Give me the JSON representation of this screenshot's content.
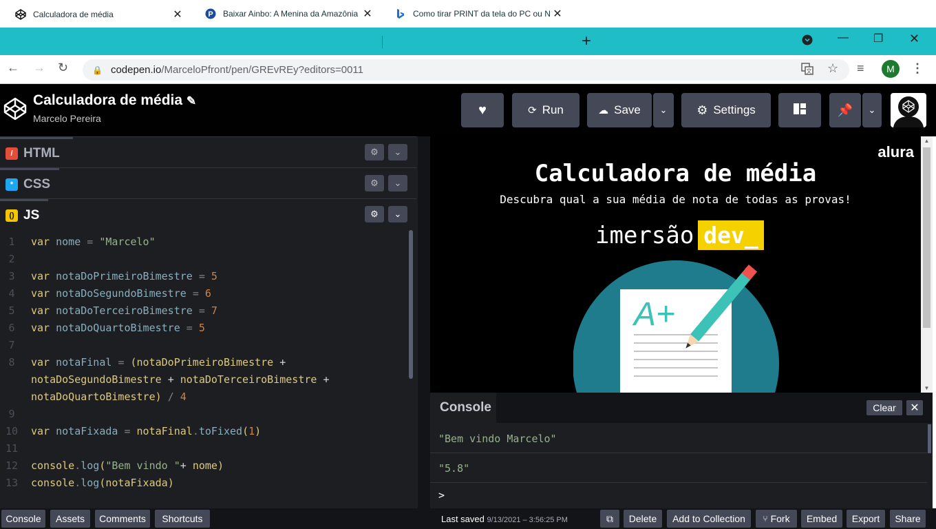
{
  "browser": {
    "tabs": [
      {
        "title": "Calculadora de média",
        "icon": "codepen-icon"
      },
      {
        "title": "Baixar Ainbo: A Menina da Amazônia",
        "icon": "pirate-bay-icon"
      },
      {
        "title": "Como tirar PRINT da tela do PC ou N",
        "icon": "bing-icon"
      }
    ],
    "url_host": "codepen.io",
    "url_path": "/MarceloPfront/pen/GREvREy?editors=0011",
    "profile_initial": "M"
  },
  "pen": {
    "title": "Calculadora de média",
    "author": "Marcelo Pereira",
    "buttons": {
      "run": "Run",
      "save": "Save",
      "settings": "Settings"
    }
  },
  "editors": {
    "html": "HTML",
    "css": "CSS",
    "js": "JS"
  },
  "code_lines": [
    {
      "n": "1"
    },
    {
      "n": "2"
    },
    {
      "n": "3"
    },
    {
      "n": "4"
    },
    {
      "n": "5"
    },
    {
      "n": "6"
    },
    {
      "n": "7"
    },
    {
      "n": "8"
    },
    {
      "n": "9"
    },
    {
      "n": "10"
    },
    {
      "n": "11"
    },
    {
      "n": "12"
    },
    {
      "n": "13"
    }
  ],
  "code": {
    "l1": [
      "var",
      "nome",
      "=",
      "\"Marcelo\""
    ],
    "l3": [
      "var",
      "notaDoPrimeiroBimestre",
      "=",
      "5"
    ],
    "l4": [
      "var",
      "notaDoSegundoBimestre",
      "=",
      "6"
    ],
    "l5": [
      "var",
      "notaDoTerceiroBimestre",
      "=",
      "7"
    ],
    "l6": [
      "var",
      "notaDoQuartoBimestre",
      "=",
      "5"
    ],
    "l8a": [
      "var",
      "notaFinal",
      "=",
      "(",
      "notaDoPrimeiroBimestre",
      "+"
    ],
    "l8b": [
      "notaDoSegundoBimestre",
      "+",
      "notaDoTerceiroBimestre",
      "+"
    ],
    "l8c": [
      "notaDoQuartoBimestre",
      ")",
      "/",
      "4"
    ],
    "l10": [
      "var",
      "notaFixada",
      "=",
      "notaFinal",
      ".",
      "toFixed",
      "(",
      "1",
      ")"
    ],
    "l12": [
      "console",
      ".",
      "log",
      "(",
      "\"Bem vindo \"",
      "+",
      "nome",
      ")"
    ],
    "l13": [
      "console",
      ".",
      "log",
      "(",
      "notaFixada",
      ")"
    ]
  },
  "preview": {
    "brand": "alura",
    "heading": "Calculadora de média",
    "subheading": "Descubra qual a sua média de nota de todas as provas!",
    "logo_text": "imersão",
    "logo_badge": "dev_",
    "grade_text": "A+"
  },
  "console": {
    "title": "Console",
    "clear": "Clear",
    "outputs": [
      "\"Bem vindo Marcelo\"",
      "\"5.8\""
    ],
    "prompt": ">"
  },
  "footer": {
    "left": [
      "Console",
      "Assets",
      "Comments",
      "Shortcuts"
    ],
    "saved_label": "Last saved",
    "saved_time": "9/13/2021 – 3:56:25 PM",
    "right": [
      "Delete",
      "Add to Collection",
      "Fork",
      "Embed",
      "Export",
      "Share"
    ]
  },
  "colors": {
    "tabstrip": "#1fbdc6",
    "codepen_bg": "#010101",
    "button": "#444857",
    "editor_bg": "#1d1e22",
    "dev_badge": "#f5d100",
    "preview_circle": "#1e7c8c"
  }
}
